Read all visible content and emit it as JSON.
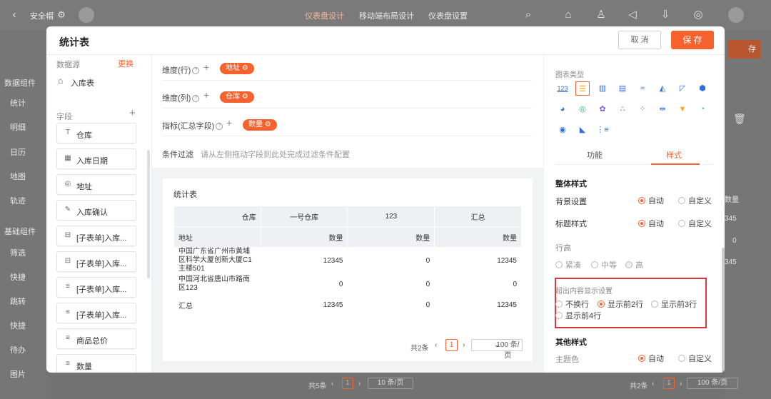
{
  "app": {
    "title": "安全帽",
    "tabs": [
      "仪表盘设计",
      "移动端布局设计",
      "仪表盘设置"
    ],
    "right_save": "存",
    "bg_sidebar": [
      "数据组件",
      "统计",
      "明细",
      "日历",
      "地图",
      "轨迹",
      "基础组件",
      "筛选",
      "快捷",
      "跳转",
      "快捷",
      "待办",
      "图片"
    ],
    "bg_right_values": [
      "数量",
      "345",
      "0",
      "345"
    ],
    "bg_pager_left": {
      "total": "共5条",
      "page": "1",
      "size": "10 条/页"
    },
    "bg_pager_right": {
      "total": "共2条",
      "page": "1",
      "size": "100 条/页"
    }
  },
  "modal": {
    "title": "统计表",
    "cancel": "取 消",
    "save": "保 存"
  },
  "left": {
    "datasource_label": "数据源",
    "change": "更换",
    "table": "入库表",
    "fields_label": "字段",
    "fields": [
      {
        "icon": "T",
        "label": "仓库"
      },
      {
        "icon": "▦",
        "label": "入库日期"
      },
      {
        "icon": "◎",
        "label": "地址"
      },
      {
        "icon": "✎",
        "label": "入库确认"
      },
      {
        "icon": "⊟",
        "label": "[子表单]入库..."
      },
      {
        "icon": "⊟",
        "label": "[子表单]入库..."
      },
      {
        "icon": "≡",
        "label": "[子表单]入库..."
      },
      {
        "icon": "≡",
        "label": "[子表单]入库..."
      },
      {
        "icon": "≡",
        "label": "商品总价"
      },
      {
        "icon": "≡",
        "label": "数量"
      }
    ]
  },
  "config": {
    "row_dim": "维度(行)",
    "row_tag": "地址",
    "col_dim": "维度(列)",
    "col_tag": "仓库",
    "metric": "指标(汇总字段)",
    "metric_tag": "数量",
    "filter_label": "条件过滤",
    "filter_hint": "请从左侧拖动字段到此处完成过滤条件配置"
  },
  "preview": {
    "title": "统计表",
    "head1": [
      "仓库",
      "一号仓库",
      "123",
      "汇总"
    ],
    "head2": [
      "地址",
      "数量",
      "数量",
      "数量"
    ],
    "rows": [
      [
        "中国广东省广州市黄埔区科学大厦创新大厦C1主楼501",
        "12345",
        "0",
        "12345"
      ],
      [
        "中国河北省唐山市路南区123",
        "0",
        "0",
        "0"
      ],
      [
        "汇总",
        "12345",
        "0",
        "12345"
      ]
    ],
    "pager": {
      "total": "共2条",
      "page": "1",
      "size": "100 条/页"
    }
  },
  "right": {
    "chart_type_label": "图表类型",
    "chart_icons": [
      "123",
      "bar-h",
      "bar",
      "bar-stack",
      "line",
      "area",
      "combo",
      "radar",
      "pie",
      "donut",
      "rose",
      "scatter",
      "bubble",
      "funnel-h",
      "funnel",
      "gauge",
      "ring",
      "map",
      "table-icon"
    ],
    "tab_function": "功能",
    "tab_style": "样式",
    "overall": "整体样式",
    "bg_setting": "背景设置",
    "title_style": "标题样式",
    "auto": "自动",
    "custom": "自定义",
    "row_height": "行高",
    "rh_options": [
      "紧凑",
      "中等",
      "高"
    ],
    "overflow": "超出内容显示设置",
    "ov_options": [
      "不换行",
      "显示前2行",
      "显示前3行",
      "显示前4行"
    ],
    "other": "其他样式",
    "theme_color": "主题色",
    "accent": "#f5622d"
  }
}
